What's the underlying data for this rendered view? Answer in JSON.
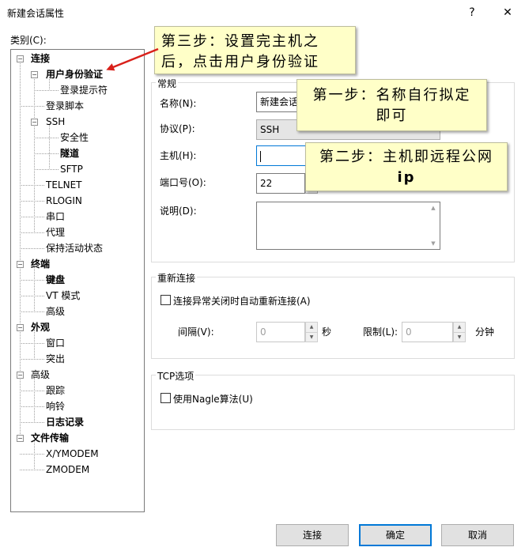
{
  "window": {
    "title": "新建会话属性",
    "help_button": "?",
    "close_button": "✕"
  },
  "category_label": "类别(C):",
  "tree": [
    {
      "label": "连接",
      "bold": true,
      "level": 0,
      "expander": "−"
    },
    {
      "label": "用户身份验证",
      "bold": true,
      "level": 1,
      "expander": "−"
    },
    {
      "label": "登录提示符",
      "bold": false,
      "level": 2
    },
    {
      "label": "登录脚本",
      "bold": false,
      "level": 1
    },
    {
      "label": "SSH",
      "bold": false,
      "level": 1,
      "expander": "−"
    },
    {
      "label": "安全性",
      "bold": false,
      "level": 2
    },
    {
      "label": "隧道",
      "bold": true,
      "level": 2
    },
    {
      "label": "SFTP",
      "bold": false,
      "level": 2
    },
    {
      "label": "TELNET",
      "bold": false,
      "level": 1
    },
    {
      "label": "RLOGIN",
      "bold": false,
      "level": 1
    },
    {
      "label": "串口",
      "bold": false,
      "level": 1
    },
    {
      "label": "代理",
      "bold": false,
      "level": 1
    },
    {
      "label": "保持活动状态",
      "bold": false,
      "level": 1
    },
    {
      "label": "终端",
      "bold": true,
      "level": 0,
      "expander": "−"
    },
    {
      "label": "键盘",
      "bold": true,
      "level": 1
    },
    {
      "label": "VT 模式",
      "bold": false,
      "level": 1
    },
    {
      "label": "高级",
      "bold": false,
      "level": 1
    },
    {
      "label": "外观",
      "bold": true,
      "level": 0,
      "expander": "−"
    },
    {
      "label": "窗口",
      "bold": false,
      "level": 1
    },
    {
      "label": "突出",
      "bold": false,
      "level": 1
    },
    {
      "label": "高级",
      "bold": false,
      "level": 0,
      "expander": "−"
    },
    {
      "label": "跟踪",
      "bold": false,
      "level": 1
    },
    {
      "label": "响铃",
      "bold": false,
      "level": 1
    },
    {
      "label": "日志记录",
      "bold": true,
      "level": 1
    },
    {
      "label": "文件传输",
      "bold": true,
      "level": 0,
      "expander": "−"
    },
    {
      "label": "X/YMODEM",
      "bold": false,
      "level": 1
    },
    {
      "label": "ZMODEM",
      "bold": false,
      "level": 1
    }
  ],
  "general": {
    "group_label": "常规",
    "name_label": "名称(N):",
    "name_value": "新建会话",
    "protocol_label": "协议(P):",
    "protocol_value": "SSH",
    "host_label": "主机(H):",
    "host_value": "",
    "port_label": "端口号(O):",
    "port_value": "22",
    "desc_label": "说明(D):",
    "desc_value": ""
  },
  "reconnect": {
    "group_label": "重新连接",
    "auto_label": "连接异常关闭时自动重新连接(A)",
    "interval_label": "间隔(V):",
    "interval_value": "0",
    "interval_unit": "秒",
    "limit_label": "限制(L):",
    "limit_value": "0",
    "limit_unit": "分钟"
  },
  "tcp": {
    "group_label": "TCP选项",
    "nagle_label": "使用Nagle算法(U)"
  },
  "buttons": {
    "connect": "连接",
    "ok": "确定",
    "cancel": "取消"
  },
  "callouts": {
    "step3": "第三步：设置完主机之后，点击用户身份验证",
    "step1": "第一步：名称自行拟定即可",
    "step2_prefix": "第二步：主机即远程公网",
    "step2_bold": "ip"
  },
  "colors": {
    "accent": "#0078d7",
    "callout_bg": "#ffffc8",
    "arrow": "#d9201a"
  }
}
